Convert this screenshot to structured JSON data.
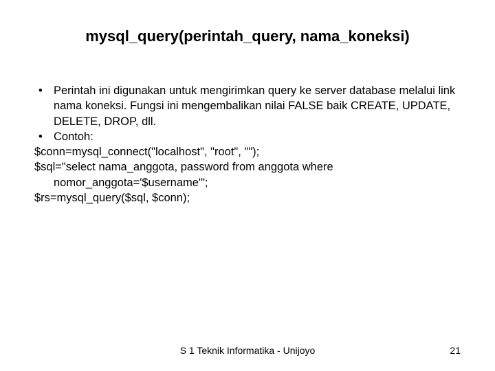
{
  "title": "mysql_query(perintah_query, nama_koneksi)",
  "bullets": [
    {
      "text": "Perintah ini digunakan untuk mengirimkan query ke server database melalui link nama koneksi. Fungsi ini mengembalikan nilai FALSE baik CREATE, UPDATE, DELETE, DROP, dll."
    },
    {
      "text": "Contoh:"
    }
  ],
  "code_lines": [
    "$conn=mysql_connect(\"localhost\", \"root\", \"\");",
    "$sql=\"select nama_anggota, password from anggota where",
    "nomor_anggota='$username'\";",
    "$rs=mysql_query($sql, $conn);"
  ],
  "footer": {
    "center": "S 1 Teknik Informatika - Unijoyo",
    "page": "21"
  }
}
